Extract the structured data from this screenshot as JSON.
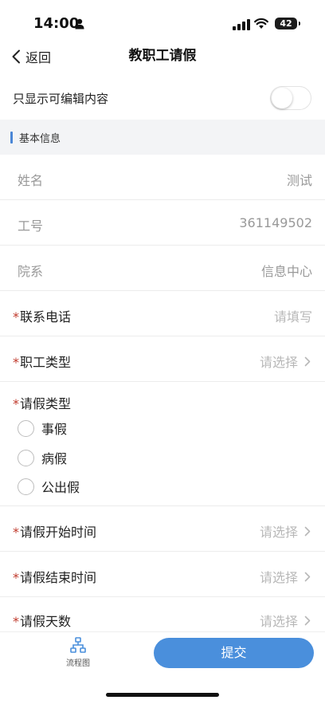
{
  "status_bar": {
    "time": "14:00",
    "battery": "42",
    "icons": [
      "person-icon",
      "signal-icon",
      "wifi-icon",
      "battery-icon"
    ]
  },
  "nav": {
    "back_label": "返回",
    "title": "教职工请假",
    "icons": [
      "chevron-left-icon"
    ]
  },
  "filter": {
    "label": "只显示可编辑内容",
    "enabled": false
  },
  "section": {
    "title": "基本信息"
  },
  "fields": {
    "name": {
      "label": "姓名",
      "value": "测试"
    },
    "staff_id": {
      "label": "工号",
      "value": "361149502"
    },
    "department": {
      "label": "院系",
      "value": "信息中心"
    },
    "phone": {
      "required_mark": "*",
      "label": "联系电话",
      "placeholder": "请填写"
    },
    "staff_type": {
      "required_mark": "*",
      "label": "职工类型",
      "placeholder": "请选择"
    },
    "leave_type": {
      "required_mark": "*",
      "label": "请假类型",
      "options": [
        "事假",
        "病假",
        "公出假"
      ],
      "selected": null
    },
    "start_time": {
      "required_mark": "*",
      "label": "请假开始时间",
      "placeholder": "请选择"
    },
    "end_time": {
      "required_mark": "*",
      "label": "请假结束时间",
      "placeholder": "请选择"
    },
    "days": {
      "required_mark": "*",
      "label": "请假天数",
      "placeholder": "请选择"
    }
  },
  "bottom": {
    "flow_label": "流程图",
    "submit_label": "提交",
    "icons": [
      "flowchart-icon"
    ]
  },
  "colors": {
    "accent": "#4a8fdc",
    "section_bar": "#4a86d6",
    "required": "#c0392b",
    "section_bg": "#f3f4f6",
    "placeholder": "#b8b8b8"
  }
}
